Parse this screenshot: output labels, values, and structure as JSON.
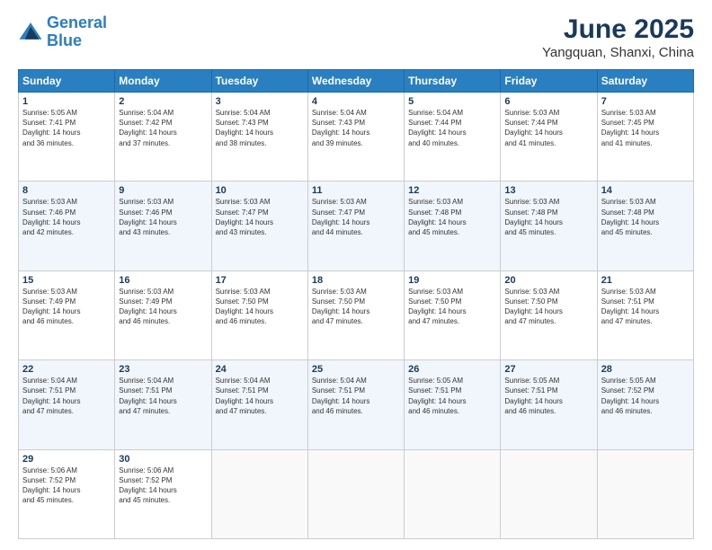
{
  "logo": {
    "line1": "General",
    "line2": "Blue"
  },
  "title": "June 2025",
  "subtitle": "Yangquan, Shanxi, China",
  "header_days": [
    "Sunday",
    "Monday",
    "Tuesday",
    "Wednesday",
    "Thursday",
    "Friday",
    "Saturday"
  ],
  "weeks": [
    [
      {
        "day": "1",
        "info": "Sunrise: 5:05 AM\nSunset: 7:41 PM\nDaylight: 14 hours\nand 36 minutes."
      },
      {
        "day": "2",
        "info": "Sunrise: 5:04 AM\nSunset: 7:42 PM\nDaylight: 14 hours\nand 37 minutes."
      },
      {
        "day": "3",
        "info": "Sunrise: 5:04 AM\nSunset: 7:43 PM\nDaylight: 14 hours\nand 38 minutes."
      },
      {
        "day": "4",
        "info": "Sunrise: 5:04 AM\nSunset: 7:43 PM\nDaylight: 14 hours\nand 39 minutes."
      },
      {
        "day": "5",
        "info": "Sunrise: 5:04 AM\nSunset: 7:44 PM\nDaylight: 14 hours\nand 40 minutes."
      },
      {
        "day": "6",
        "info": "Sunrise: 5:03 AM\nSunset: 7:44 PM\nDaylight: 14 hours\nand 41 minutes."
      },
      {
        "day": "7",
        "info": "Sunrise: 5:03 AM\nSunset: 7:45 PM\nDaylight: 14 hours\nand 41 minutes."
      }
    ],
    [
      {
        "day": "8",
        "info": "Sunrise: 5:03 AM\nSunset: 7:46 PM\nDaylight: 14 hours\nand 42 minutes."
      },
      {
        "day": "9",
        "info": "Sunrise: 5:03 AM\nSunset: 7:46 PM\nDaylight: 14 hours\nand 43 minutes."
      },
      {
        "day": "10",
        "info": "Sunrise: 5:03 AM\nSunset: 7:47 PM\nDaylight: 14 hours\nand 43 minutes."
      },
      {
        "day": "11",
        "info": "Sunrise: 5:03 AM\nSunset: 7:47 PM\nDaylight: 14 hours\nand 44 minutes."
      },
      {
        "day": "12",
        "info": "Sunrise: 5:03 AM\nSunset: 7:48 PM\nDaylight: 14 hours\nand 45 minutes."
      },
      {
        "day": "13",
        "info": "Sunrise: 5:03 AM\nSunset: 7:48 PM\nDaylight: 14 hours\nand 45 minutes."
      },
      {
        "day": "14",
        "info": "Sunrise: 5:03 AM\nSunset: 7:48 PM\nDaylight: 14 hours\nand 45 minutes."
      }
    ],
    [
      {
        "day": "15",
        "info": "Sunrise: 5:03 AM\nSunset: 7:49 PM\nDaylight: 14 hours\nand 46 minutes."
      },
      {
        "day": "16",
        "info": "Sunrise: 5:03 AM\nSunset: 7:49 PM\nDaylight: 14 hours\nand 46 minutes."
      },
      {
        "day": "17",
        "info": "Sunrise: 5:03 AM\nSunset: 7:50 PM\nDaylight: 14 hours\nand 46 minutes."
      },
      {
        "day": "18",
        "info": "Sunrise: 5:03 AM\nSunset: 7:50 PM\nDaylight: 14 hours\nand 47 minutes."
      },
      {
        "day": "19",
        "info": "Sunrise: 5:03 AM\nSunset: 7:50 PM\nDaylight: 14 hours\nand 47 minutes."
      },
      {
        "day": "20",
        "info": "Sunrise: 5:03 AM\nSunset: 7:50 PM\nDaylight: 14 hours\nand 47 minutes."
      },
      {
        "day": "21",
        "info": "Sunrise: 5:03 AM\nSunset: 7:51 PM\nDaylight: 14 hours\nand 47 minutes."
      }
    ],
    [
      {
        "day": "22",
        "info": "Sunrise: 5:04 AM\nSunset: 7:51 PM\nDaylight: 14 hours\nand 47 minutes."
      },
      {
        "day": "23",
        "info": "Sunrise: 5:04 AM\nSunset: 7:51 PM\nDaylight: 14 hours\nand 47 minutes."
      },
      {
        "day": "24",
        "info": "Sunrise: 5:04 AM\nSunset: 7:51 PM\nDaylight: 14 hours\nand 47 minutes."
      },
      {
        "day": "25",
        "info": "Sunrise: 5:04 AM\nSunset: 7:51 PM\nDaylight: 14 hours\nand 46 minutes."
      },
      {
        "day": "26",
        "info": "Sunrise: 5:05 AM\nSunset: 7:51 PM\nDaylight: 14 hours\nand 46 minutes."
      },
      {
        "day": "27",
        "info": "Sunrise: 5:05 AM\nSunset: 7:51 PM\nDaylight: 14 hours\nand 46 minutes."
      },
      {
        "day": "28",
        "info": "Sunrise: 5:05 AM\nSunset: 7:52 PM\nDaylight: 14 hours\nand 46 minutes."
      }
    ],
    [
      {
        "day": "29",
        "info": "Sunrise: 5:06 AM\nSunset: 7:52 PM\nDaylight: 14 hours\nand 45 minutes."
      },
      {
        "day": "30",
        "info": "Sunrise: 5:06 AM\nSunset: 7:52 PM\nDaylight: 14 hours\nand 45 minutes."
      },
      {
        "day": "",
        "info": ""
      },
      {
        "day": "",
        "info": ""
      },
      {
        "day": "",
        "info": ""
      },
      {
        "day": "",
        "info": ""
      },
      {
        "day": "",
        "info": ""
      }
    ]
  ]
}
